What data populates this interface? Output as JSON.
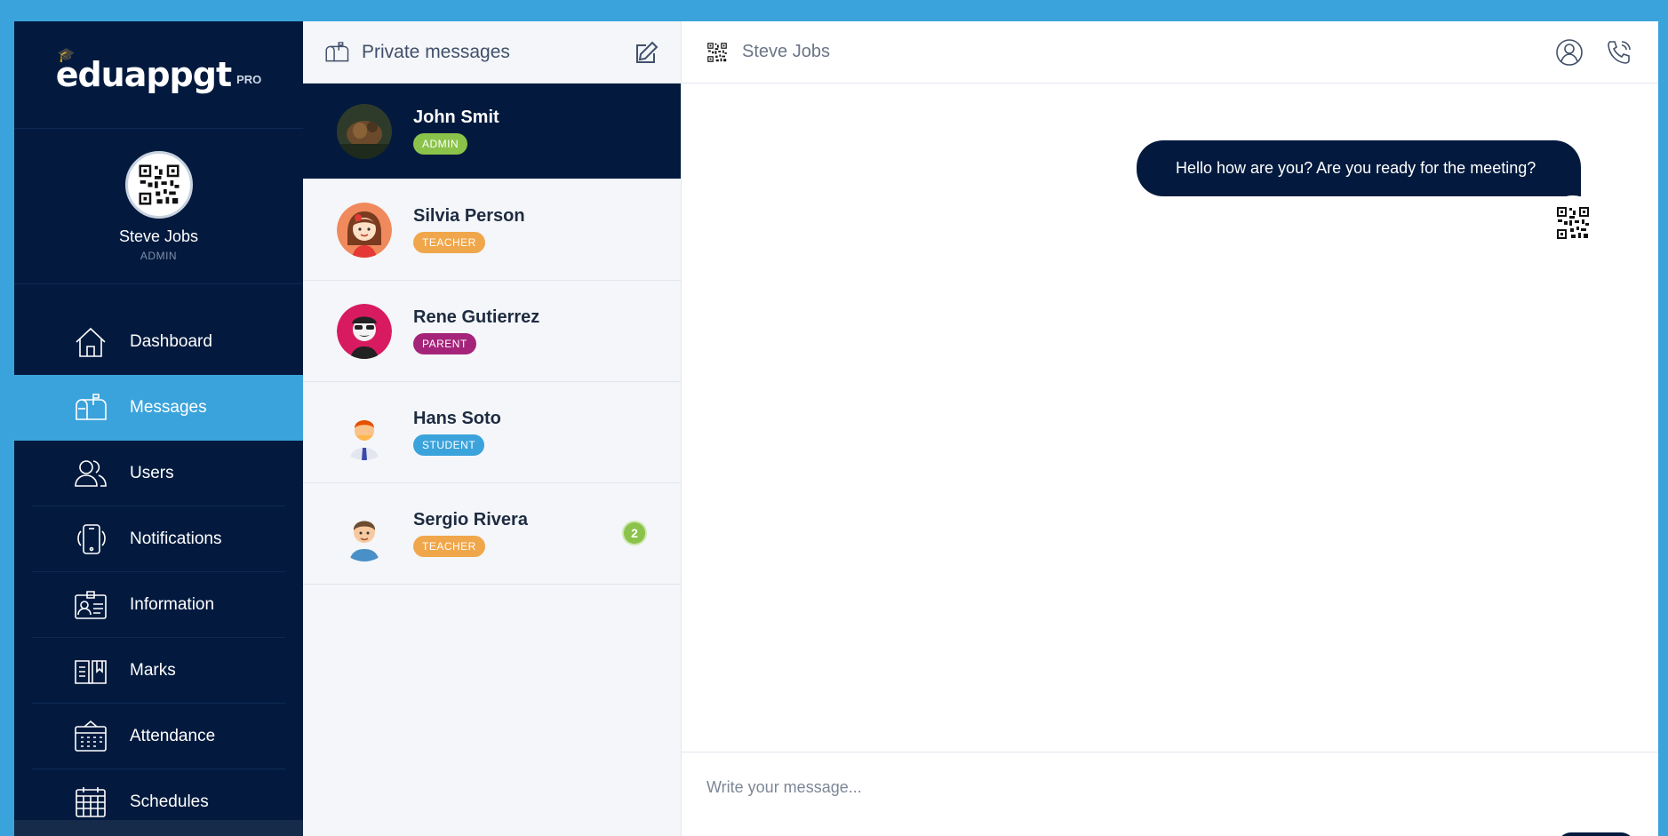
{
  "brand": {
    "logo_text": "eduappgt",
    "logo_suffix": "PRO"
  },
  "profile": {
    "name": "Steve Jobs",
    "role": "ADMIN"
  },
  "nav": [
    {
      "label": "Dashboard",
      "icon": "home-icon"
    },
    {
      "label": "Messages",
      "icon": "mailbox-icon"
    },
    {
      "label": "Users",
      "icon": "users-icon"
    },
    {
      "label": "Notifications",
      "icon": "phone-notification-icon"
    },
    {
      "label": "Information",
      "icon": "id-card-icon"
    },
    {
      "label": "Marks",
      "icon": "book-icon"
    },
    {
      "label": "Attendance",
      "icon": "calendar-board-icon"
    },
    {
      "label": "Schedules",
      "icon": "calendar-icon"
    }
  ],
  "conversations": {
    "title": "Private messages",
    "contacts": [
      {
        "name": "John Smit",
        "role": "ADMIN",
        "role_color": "#8bc34a"
      },
      {
        "name": "Silvia Person",
        "role": "TEACHER",
        "role_color": "#f0a64b"
      },
      {
        "name": "Rene Gutierrez",
        "role": "PARENT",
        "role_color": "#a5247a"
      },
      {
        "name": "Hans Soto",
        "role": "STUDENT",
        "role_color": "#3ba3db"
      },
      {
        "name": "Sergio Rivera",
        "role": "TEACHER",
        "role_color": "#f0a64b",
        "unread": "2"
      }
    ]
  },
  "chat": {
    "title": "Steve Jobs",
    "messages": [
      {
        "text": "Hello how are you? Are you ready for the meeting?"
      }
    ],
    "composer_placeholder": "Write your message..."
  },
  "colors": {
    "accent": "#3ba3db",
    "sidebar": "#031a3e"
  }
}
